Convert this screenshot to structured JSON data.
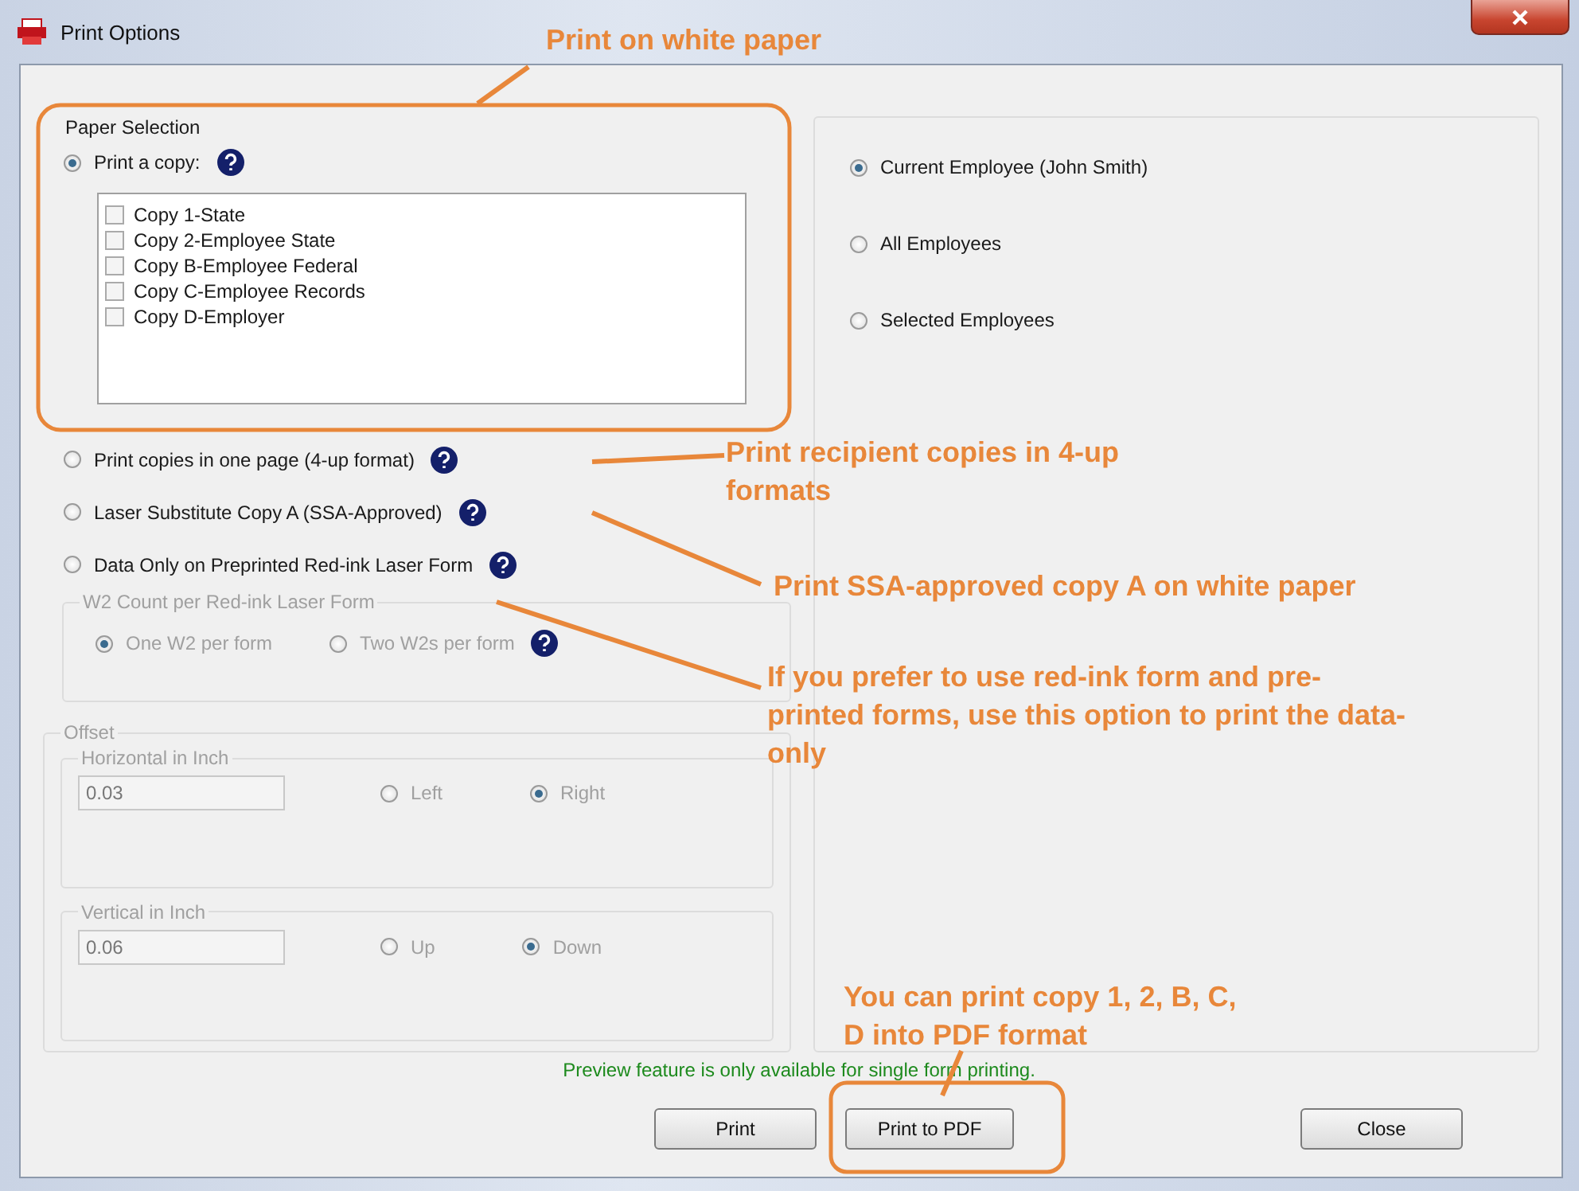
{
  "window": {
    "title": "Print Options"
  },
  "paper_selection": {
    "label": "Paper Selection",
    "options": [
      {
        "kind": "copies",
        "label": "Print a copy:",
        "selected": true,
        "help": true,
        "copies": [
          {
            "label": "Copy 1-State",
            "checked": false
          },
          {
            "label": "Copy 2-Employee State",
            "checked": false
          },
          {
            "label": "Copy B-Employee Federal",
            "checked": false
          },
          {
            "label": "Copy C-Employee Records",
            "checked": false
          },
          {
            "label": "Copy D-Employer",
            "checked": false
          }
        ]
      },
      {
        "kind": "plain",
        "label": "Print copies in one page (4-up format)",
        "selected": false,
        "help": true
      },
      {
        "kind": "plain",
        "label": "Laser Substitute Copy A (SSA-Approved)",
        "selected": false,
        "help": true
      },
      {
        "kind": "plain",
        "label": "Data Only on Preprinted Red-ink Laser Form",
        "selected": false,
        "help": true
      }
    ]
  },
  "w2_count": {
    "label": "W2 Count per Red-ink Laser Form",
    "disabled": true,
    "options": [
      {
        "label": "One W2 per form",
        "selected": true,
        "help": false
      },
      {
        "label": "Two W2s per form",
        "selected": false,
        "help": true
      }
    ]
  },
  "offset": {
    "label": "Offset",
    "disabled": true,
    "groups": [
      {
        "label": "Horizontal in Inch",
        "value": "0.03",
        "options": [
          {
            "label": "Left",
            "selected": false
          },
          {
            "label": "Right",
            "selected": true
          }
        ]
      },
      {
        "label": "Vertical in Inch",
        "value": "0.06",
        "options": [
          {
            "label": "Up",
            "selected": false
          },
          {
            "label": "Down",
            "selected": true
          }
        ]
      }
    ]
  },
  "employees": [
    {
      "label": "Current Employee (John Smith)",
      "selected": true
    },
    {
      "label": "All Employees",
      "selected": false
    },
    {
      "label": "Selected Employees",
      "selected": false
    }
  ],
  "notice": "Preview feature is only available for single form printing.",
  "buttons": [
    "Print",
    "Print to PDF",
    "Close"
  ],
  "annotations": [
    {
      "lines": [
        "Print on white paper"
      ]
    },
    {
      "lines": [
        "Print recipient copies in 4-up",
        "formats"
      ]
    },
    {
      "lines": [
        "Print SSA-approved copy A on white paper"
      ]
    },
    {
      "lines": [
        "If you prefer to use red-ink form and pre-",
        "printed forms, use this option to print the data-",
        "only"
      ]
    },
    {
      "lines": [
        "You can print copy 1, 2, B, C,",
        "D into PDF format"
      ]
    }
  ]
}
